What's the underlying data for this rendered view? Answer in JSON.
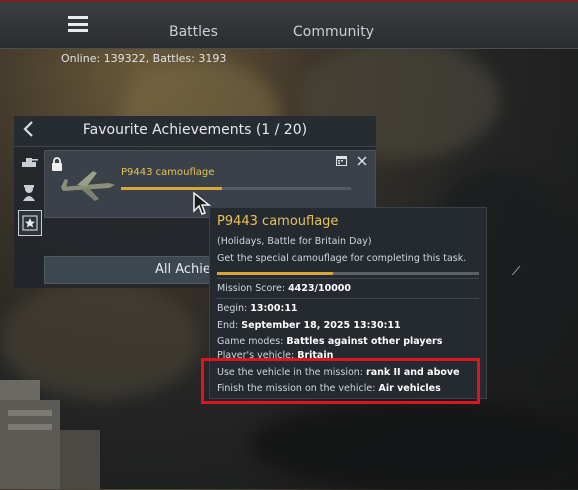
{
  "nav": {
    "menu_icon": "hamburger-icon",
    "items": [
      "Battles",
      "Community"
    ]
  },
  "status": {
    "online_text": "Online: 139322, Battles: 3193"
  },
  "panel": {
    "title": "Favourite Achievements (1 / 20)",
    "back_icon": "chevron-left-icon",
    "side_tabs": [
      "tank-icon",
      "soldier-icon",
      "star-icon"
    ],
    "achievement": {
      "name": "P9443 camouflage",
      "progress": 0.44,
      "icons": [
        "lock-icon",
        "calendar-icon",
        "close-icon",
        "plane-icon"
      ]
    },
    "all_button_label": "All Achie"
  },
  "tooltip": {
    "title": "P9443 camouflage",
    "subtitle": "(Holidays, Battle for Britain Day)",
    "description": "Get the special camouflage for completing this task.",
    "progress": 0.4423,
    "score_label": "Mission Score: ",
    "score_value": "4423/10000",
    "begin_label": "Begin: ",
    "begin_value": "13:00:11",
    "end_label": "End: ",
    "end_value": "September 18, 2025 13:30:11",
    "modes_label": "Game modes: ",
    "modes_value": "Battles against other players",
    "vehicle_label": "Player's vehicle: ",
    "vehicle_value": "Britain",
    "use_label": "Use the vehicle in the mission: ",
    "use_value": "rank II and above",
    "finish_label": "Finish the mission on the vehicle: ",
    "finish_value": "Air vehicles"
  },
  "colors": {
    "accent": "#d9a53c",
    "title_gold": "#e8c25a",
    "highlight": "#e0141e"
  }
}
